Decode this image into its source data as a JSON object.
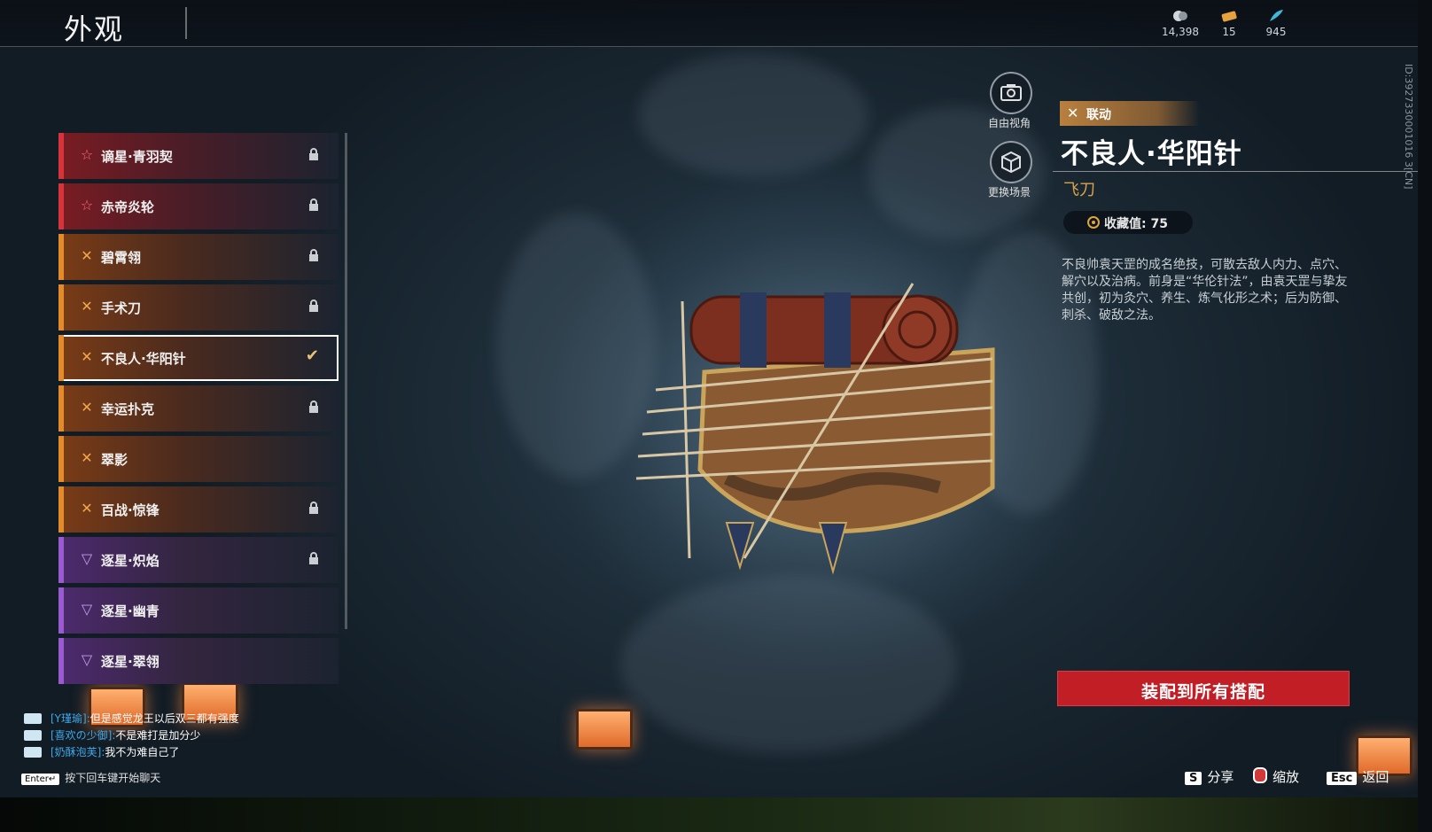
{
  "header": {
    "title": "外观",
    "currencies": [
      {
        "icon": "coin-icon",
        "value": "14,398"
      },
      {
        "icon": "ticket-icon",
        "value": "15"
      },
      {
        "icon": "feather-icon",
        "value": "945"
      }
    ],
    "side_id": "ID:3927330001016 3[CN]"
  },
  "skin_list": {
    "items": [
      {
        "label": "谪星·青羽契",
        "rarity": "red",
        "state": "locked"
      },
      {
        "label": "赤帝炎轮",
        "rarity": "red",
        "state": "locked"
      },
      {
        "label": "碧霄翎",
        "rarity": "gold",
        "state": "locked"
      },
      {
        "label": "手术刀",
        "rarity": "gold",
        "state": "locked"
      },
      {
        "label": "不良人·华阳针",
        "rarity": "gold",
        "state": "equipped"
      },
      {
        "label": "幸运扑克",
        "rarity": "gold",
        "state": "locked"
      },
      {
        "label": "翠影",
        "rarity": "gold",
        "state": "owned"
      },
      {
        "label": "百战·惊锋",
        "rarity": "gold",
        "state": "locked"
      },
      {
        "label": "逐星·炽焰",
        "rarity": "purple",
        "state": "locked"
      },
      {
        "label": "逐星·幽青",
        "rarity": "purple",
        "state": "owned"
      },
      {
        "label": "逐星·翠翎",
        "rarity": "purple",
        "state": "owned"
      }
    ]
  },
  "camera": {
    "free_view_label": "自由视角",
    "change_scene_label": "更换场景"
  },
  "detail": {
    "tag": "联动",
    "name": "不良人·华阳针",
    "type": "飞刀",
    "collect_label": "收藏值: 75",
    "description": "不良帅袁天罡的成名绝技，可散去敌人内力、点穴、解穴以及治病。前身是“华伦针法”，由袁天罡与挚友共创，初为灸穴、养生、炼气化形之术；后为防御、刺杀、破敌之法。",
    "equip_button": "装配到所有搭配"
  },
  "chat": {
    "lines": [
      {
        "who": "[Y瑾瑜]:",
        "text": "但是感觉龙王以后双三都有强度"
      },
      {
        "who": "[喜欢の少御]:",
        "text": "不是难打是加分少"
      },
      {
        "who": "[奶酥泡芙]:",
        "text": "我不为难自己了"
      }
    ],
    "enter_key": "Enter↵",
    "hint": "按下回车键开始聊天"
  },
  "footer": {
    "share_key": "S",
    "share_label": "分享",
    "zoom_label": "缩放",
    "back_key": "Esc",
    "back_label": "返回"
  },
  "colors": {
    "accent_red": "#c21e25",
    "gold": "#d9a24b",
    "chat_name": "#3ea7e6"
  }
}
